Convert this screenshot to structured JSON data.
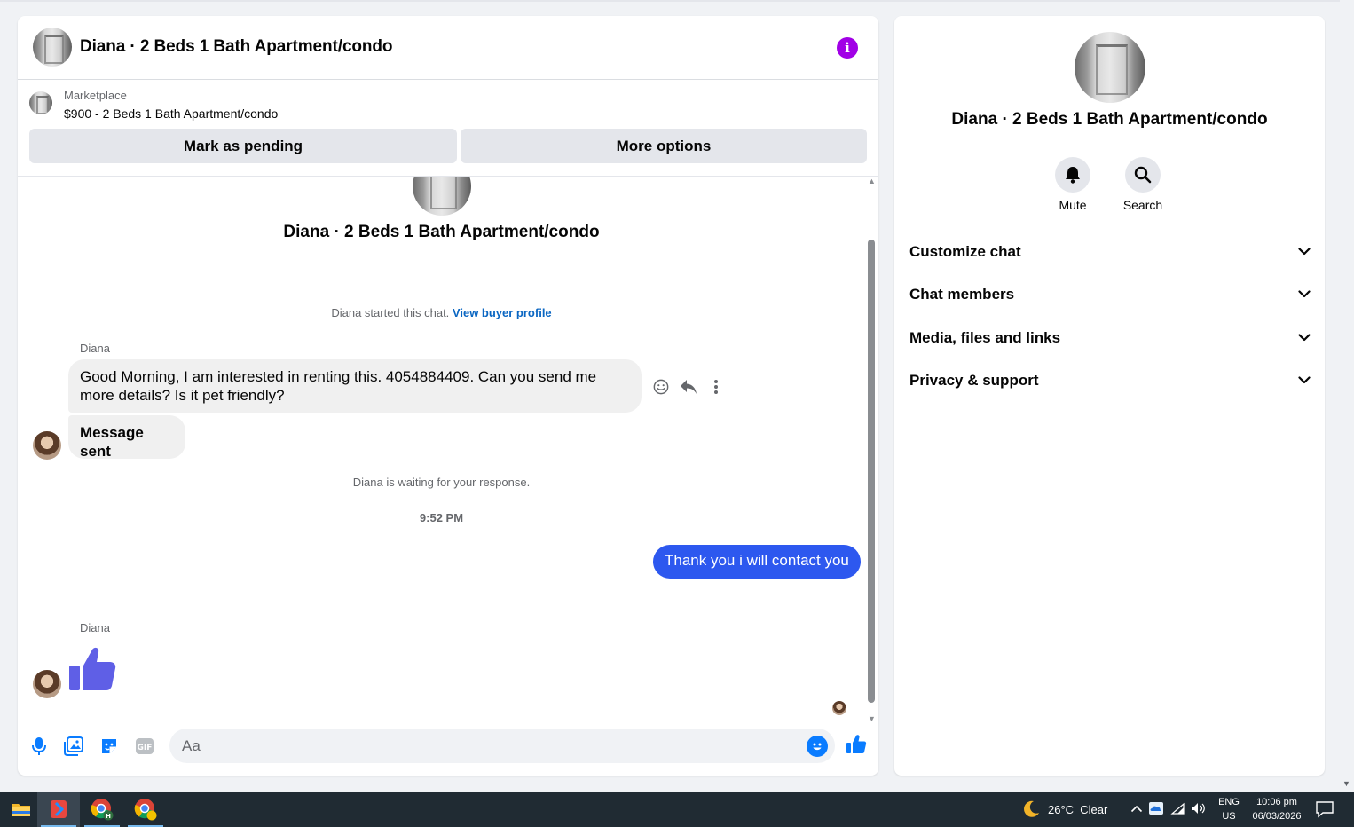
{
  "chat": {
    "title": "Diana · 2 Beds 1 Bath Apartment/condo",
    "marketplace_label": "Marketplace",
    "listing": "$900 - 2 Beds 1 Bath Apartment/condo",
    "mark_pending": "Mark as pending",
    "more_options": "More options",
    "intro_title": "Diana · 2 Beds 1 Bath Apartment/condo",
    "started_text": "Diana started this chat.",
    "view_profile": "View buyer profile",
    "messages": [
      {
        "sender": "Diana",
        "text": "Good Morning, I am interested in renting this. 4054884409. Can you send me more details? Is it pet friendly?"
      },
      {
        "text": "Message sent"
      }
    ],
    "waiting_text": "Diana is waiting for your response.",
    "timestamp": "9:52 PM",
    "outgoing": "Thank you i will contact you",
    "sender2": "Diana",
    "composer_placeholder": "Aa"
  },
  "info": {
    "title": "Diana · 2 Beds 1 Bath Apartment/condo",
    "mute": "Mute",
    "search": "Search",
    "sections": [
      "Customize chat",
      "Chat members",
      "Media, files and links",
      "Privacy & support"
    ]
  },
  "taskbar": {
    "weather": "26°C  Clear",
    "lang_top": "ENG",
    "lang_bottom": "US",
    "time": "10:06 pm",
    "date": "06/03/2026"
  },
  "colors": {
    "accent_blue": "#0a7cff",
    "outgoing_bubble": "#2d58ef",
    "info_purple": "#a100e6",
    "like_purple": "#5f5fe6"
  }
}
